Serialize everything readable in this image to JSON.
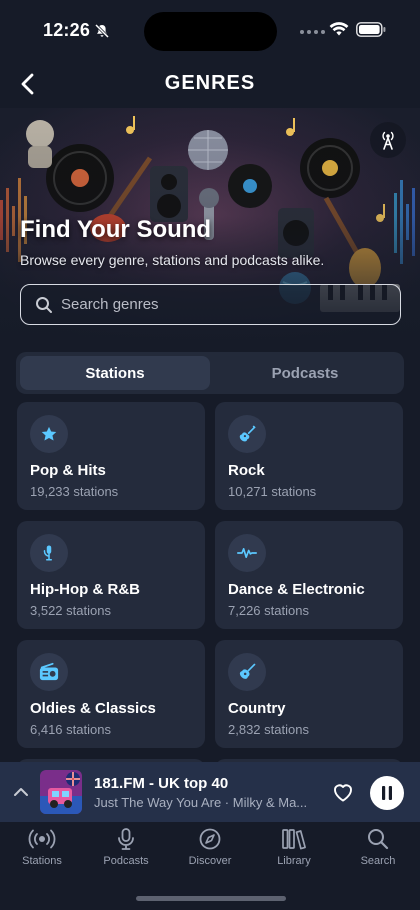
{
  "status": {
    "time": "12:26"
  },
  "header": {
    "title": "GENRES"
  },
  "hero": {
    "title": "Find Your Sound",
    "subtitle": "Browse every genre, stations and podcasts alike."
  },
  "search": {
    "placeholder": "Search genres",
    "value": ""
  },
  "tabs": [
    {
      "label": "Stations",
      "active": true
    },
    {
      "label": "Podcasts",
      "active": false
    }
  ],
  "genres": [
    {
      "name": "Pop & Hits",
      "count": "19,233 stations",
      "icon": "star-icon"
    },
    {
      "name": "Rock",
      "count": "10,271 stations",
      "icon": "guitar-icon"
    },
    {
      "name": "Hip-Hop & R&B",
      "count": "3,522 stations",
      "icon": "microphone-icon"
    },
    {
      "name": "Dance & Electronic",
      "count": "7,226 stations",
      "icon": "waveform-icon"
    },
    {
      "name": "Oldies & Classics",
      "count": "6,416 stations",
      "icon": "radio-icon"
    },
    {
      "name": "Country",
      "count": "2,832 stations",
      "icon": "acoustic-guitar-icon"
    }
  ],
  "player": {
    "title": "181.FM - UK top 40",
    "subtitle": "Just The Way You Are  · Milky & Ma..."
  },
  "tabbar": [
    {
      "label": "Stations",
      "icon": "broadcast-icon"
    },
    {
      "label": "Podcasts",
      "icon": "microphone-icon"
    },
    {
      "label": "Discover",
      "icon": "compass-icon"
    },
    {
      "label": "Library",
      "icon": "library-icon"
    },
    {
      "label": "Search",
      "icon": "search-icon"
    }
  ],
  "colors": {
    "background": "#161b28",
    "card": "#242b3c",
    "accent_icon": "#5bc8ff",
    "player_bar": "#253049"
  }
}
